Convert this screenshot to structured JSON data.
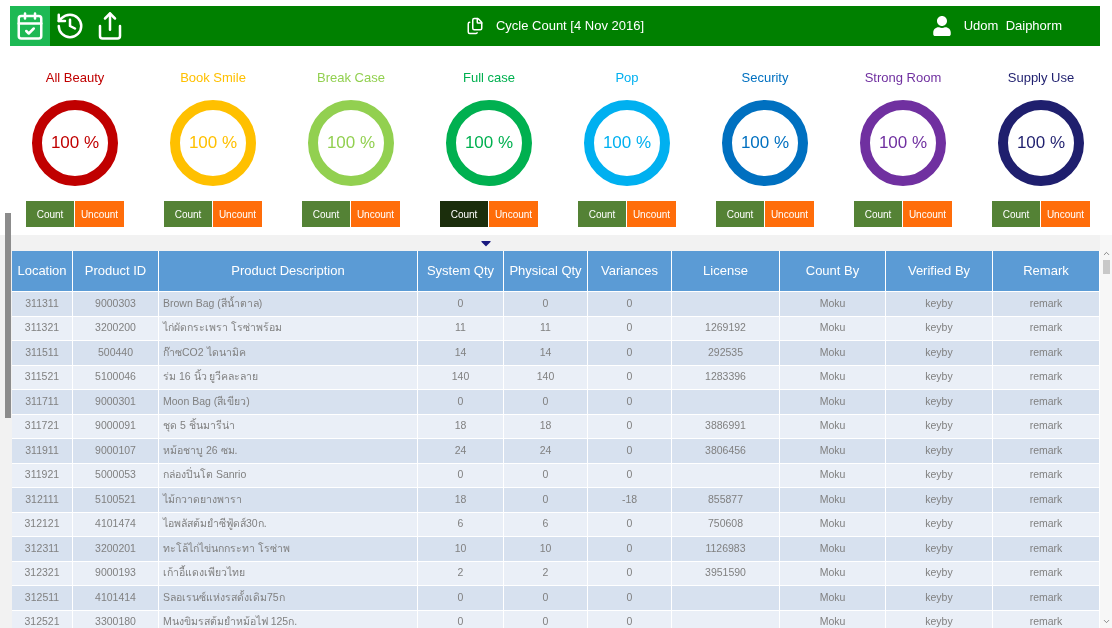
{
  "header": {
    "title": "Cycle Count [4 Nov 2016]",
    "user": "Udom  Daiphorm",
    "tools": [
      {
        "kind": "calendar",
        "selected": true
      },
      {
        "kind": "history",
        "selected": false
      },
      {
        "kind": "export",
        "selected": false
      }
    ]
  },
  "categories": [
    {
      "name": "All Beauty",
      "color": "#c00000",
      "percent": "100 %",
      "count_label": "Count",
      "uncount_label": "Uncount",
      "selected": false
    },
    {
      "name": "Book Smile",
      "color": "#ffc000",
      "percent": "100 %",
      "count_label": "Count",
      "uncount_label": "Uncount",
      "selected": false
    },
    {
      "name": "Break Case",
      "color": "#92d050",
      "percent": "100 %",
      "count_label": "Count",
      "uncount_label": "Uncount",
      "selected": false
    },
    {
      "name": "Full case",
      "color": "#00b050",
      "percent": "100 %",
      "count_label": "Count",
      "uncount_label": "Uncount",
      "selected": true
    },
    {
      "name": "Pop",
      "color": "#00b0f0",
      "percent": "100 %",
      "count_label": "Count",
      "uncount_label": "Uncount",
      "selected": false
    },
    {
      "name": "Security",
      "color": "#0070c0",
      "percent": "100 %",
      "count_label": "Count",
      "uncount_label": "Uncount",
      "selected": false
    },
    {
      "name": "Strong Room",
      "color": "#7030a0",
      "percent": "100 %",
      "count_label": "Count",
      "uncount_label": "Uncount",
      "selected": false
    },
    {
      "name": "Supply Use",
      "color": "#1f1f6e",
      "percent": "100 %",
      "count_label": "Count",
      "uncount_label": "Uncount",
      "selected": false
    }
  ],
  "table": {
    "columns": [
      "Location",
      "Product ID",
      "Product Description",
      "System Qty",
      "Physical Qty",
      "Variances",
      "License",
      "Count By",
      "Verified By",
      "Remark"
    ],
    "rows": [
      [
        "311311",
        "9000303",
        "Brown Bag (สีน้ำตาล)",
        "0",
        "0",
        "0",
        "",
        "Moku",
        "keyby",
        "remark"
      ],
      [
        "311321",
        "3200200",
        "ไก่ผัดกระเพรา โรซ่าพร้อม",
        "11",
        "11",
        "0",
        "1269192",
        "Moku",
        "keyby",
        "remark"
      ],
      [
        "311511",
        "500440",
        "ก๊าซCO2 ไดนามิค",
        "14",
        "14",
        "0",
        "292535",
        "Moku",
        "keyby",
        "remark"
      ],
      [
        "311521",
        "5100046",
        "ร่ม 16 นิ้ว ยูวีคละลาย",
        "140",
        "140",
        "0",
        "1283396",
        "Moku",
        "keyby",
        "remark"
      ],
      [
        "311711",
        "9000301",
        "Moon Bag (สีเขียว)",
        "0",
        "0",
        "0",
        "",
        "Moku",
        "keyby",
        "remark"
      ],
      [
        "311721",
        "9000091",
        "ชุด 5 ชิ้นมารีน่า",
        "18",
        "18",
        "0",
        "3886991",
        "Moku",
        "keyby",
        "remark"
      ],
      [
        "311911",
        "9000107",
        "หม้อชาบู 26 ซม.",
        "24",
        "24",
        "0",
        "3806456",
        "Moku",
        "keyby",
        "remark"
      ],
      [
        "311921",
        "5000053",
        "กล่องปิ่นโต Sanrio",
        "0",
        "0",
        "0",
        "",
        "Moku",
        "keyby",
        "remark"
      ],
      [
        "312111",
        "5100521",
        "ไม้กวาดยางพารา",
        "18",
        "0",
        "-18",
        "855877",
        "Moku",
        "keyby",
        "remark"
      ],
      [
        "312121",
        "4101474",
        "ไอพลัสต้มยำซีฟู้ดส์30ก.",
        "6",
        "6",
        "0",
        "750608",
        "Moku",
        "keyby",
        "remark"
      ],
      [
        "312311",
        "3200201",
        "ทะโล้ไก่ไข่นกกระทา โรซ่าพ",
        "10",
        "10",
        "0",
        "1126983",
        "Moku",
        "keyby",
        "remark"
      ],
      [
        "312321",
        "9000193",
        "เก้าอี้แดงเพียวไทย",
        "2",
        "2",
        "0",
        "3951590",
        "Moku",
        "keyby",
        "remark"
      ],
      [
        "312511",
        "4101414",
        "Sลอเรนซ์แห่งรสดั้งเดิม75ก",
        "0",
        "0",
        "0",
        "",
        "Moku",
        "keyby",
        "remark"
      ],
      [
        "312521",
        "3300180",
        "Mนงขิมรสต้มยำหม้อไฟ 125ก.",
        "0",
        "0",
        "0",
        "",
        "Moku",
        "keyby",
        "remark"
      ]
    ]
  }
}
